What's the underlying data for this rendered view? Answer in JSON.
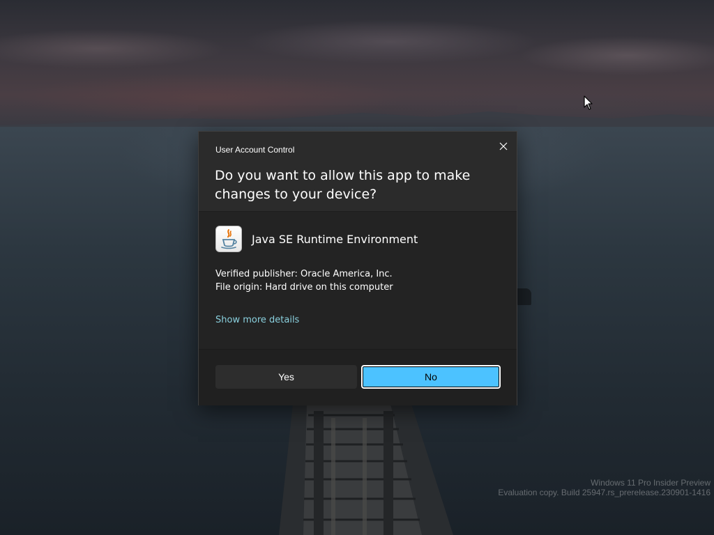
{
  "dialog": {
    "caption": "User Account Control",
    "question": "Do you want to allow this app to make changes to your device?",
    "app_name": "Java SE Runtime Environment",
    "publisher": "Verified publisher: Oracle America, Inc.",
    "origin": "File origin: Hard drive on this computer",
    "details_link": "Show more details",
    "yes_label": "Yes",
    "no_label": "No",
    "close_icon": "close-icon",
    "app_icon": "java-icon"
  },
  "watermark": {
    "line1": "Windows 11 Pro Insider Preview",
    "line2": "Evaluation copy. Build 25947.rs_prerelease.230901-1416"
  },
  "colors": {
    "primary_button": "#4cc2ff",
    "link": "#8ad0de",
    "dialog_background": "#2b2b2b"
  }
}
